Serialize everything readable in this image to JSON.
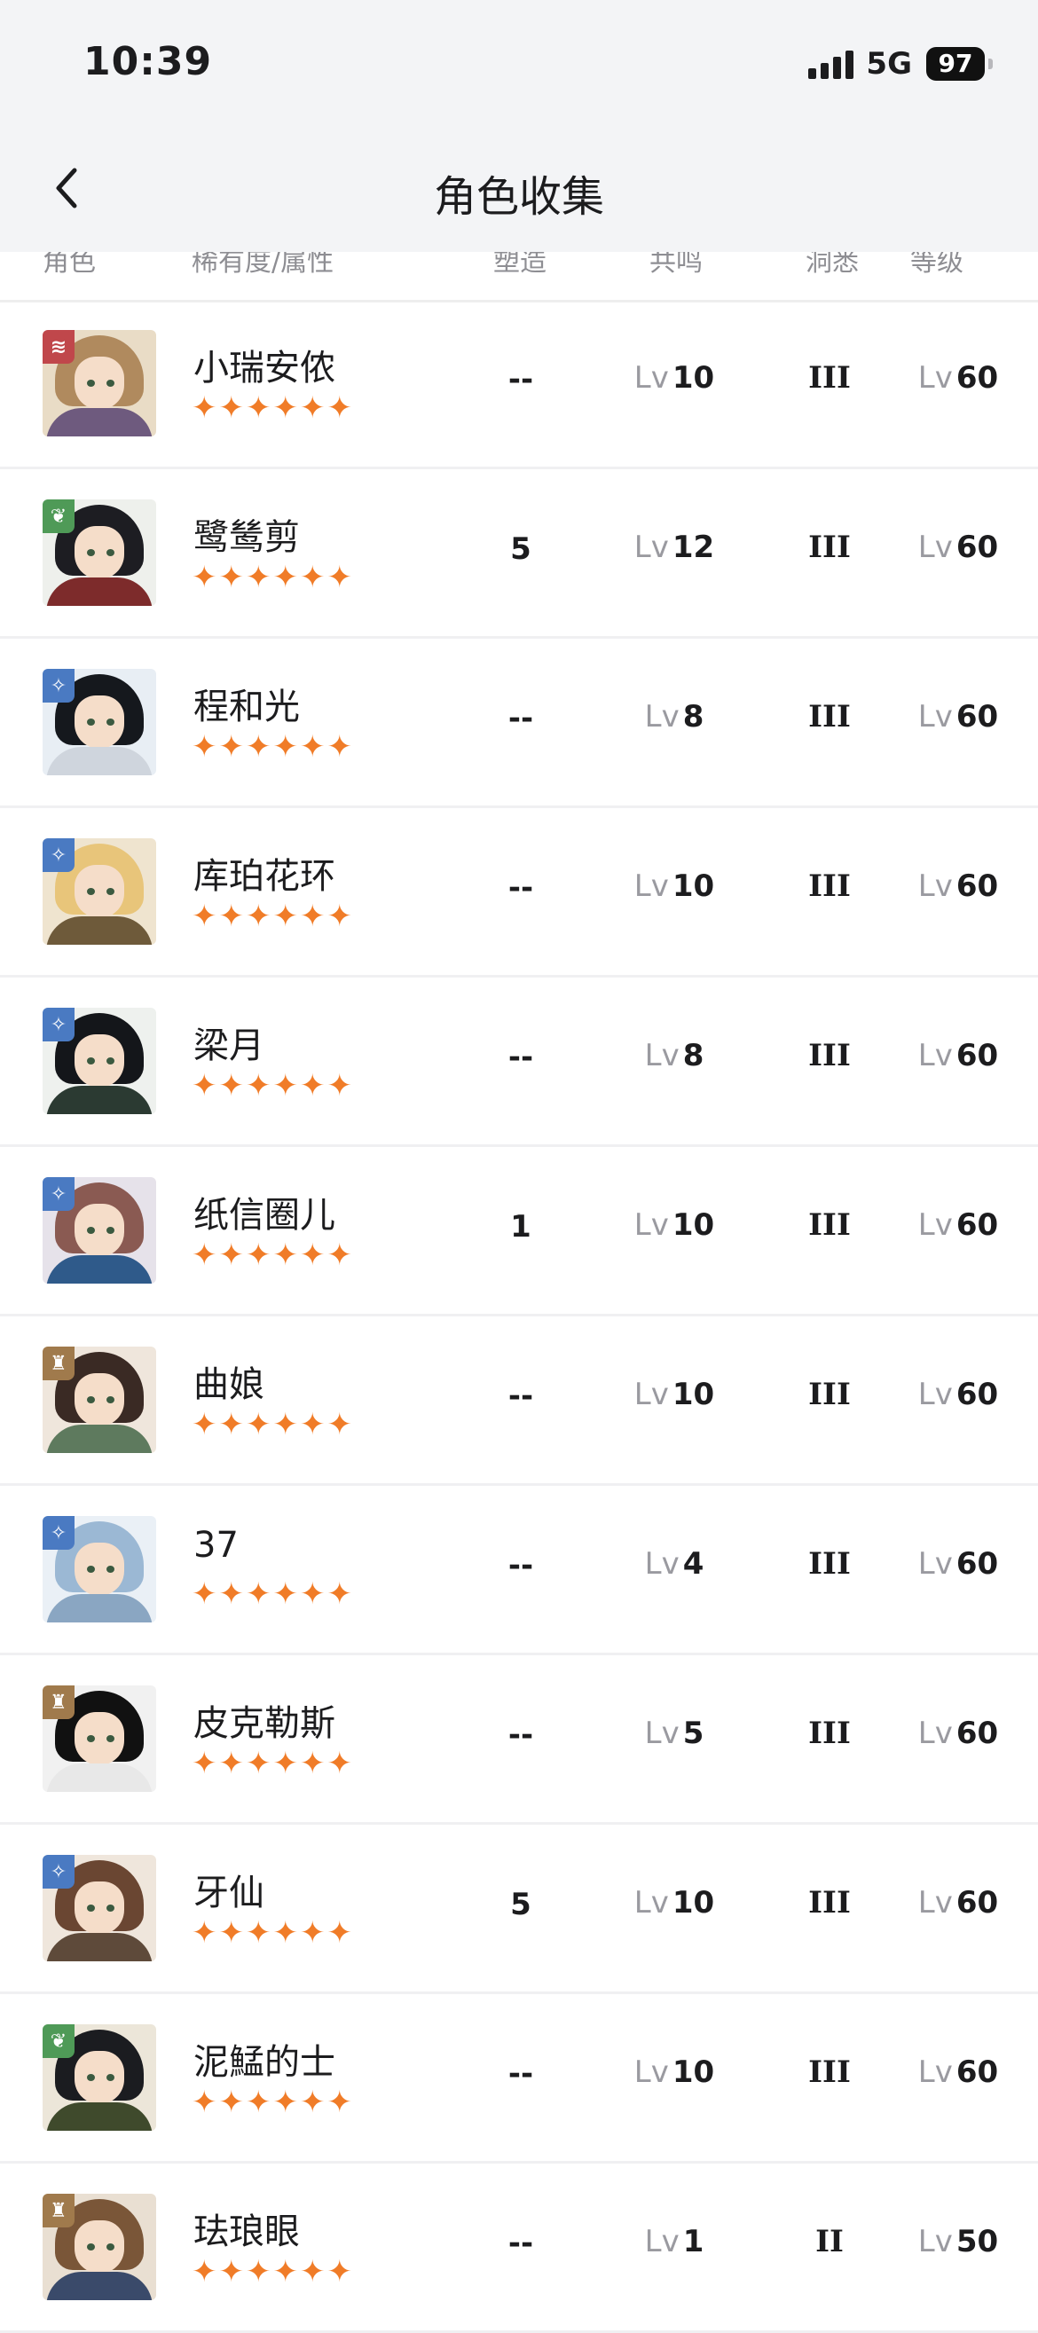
{
  "status_bar": {
    "time": "10:39",
    "network": "5G",
    "battery": "97"
  },
  "progress": 0.9,
  "header": {
    "title": "角色收集"
  },
  "columns": [
    "角色",
    "稀有度/属性",
    "塑造",
    "共鸣",
    "洞悉",
    "等级"
  ],
  "level_prefix": "Lv",
  "characters": [
    {
      "name": "小瑞安侬",
      "rarity": "✦✦✦✦✦✦",
      "element": "wind",
      "shaping": "--",
      "resonance": "10",
      "insight": "III",
      "level": "60"
    },
    {
      "name": "鹭鸶剪",
      "rarity": "✦✦✦✦✦✦",
      "element": "leaf",
      "shaping": "5",
      "resonance": "12",
      "insight": "III",
      "level": "60"
    },
    {
      "name": "程和光",
      "rarity": "✦✦✦✦✦✦",
      "element": "star",
      "shaping": "--",
      "resonance": "8",
      "insight": "III",
      "level": "60"
    },
    {
      "name": "库珀花环",
      "rarity": "✦✦✦✦✦✦",
      "element": "star",
      "shaping": "--",
      "resonance": "10",
      "insight": "III",
      "level": "60"
    },
    {
      "name": "梁月",
      "rarity": "✦✦✦✦✦✦",
      "element": "star",
      "shaping": "--",
      "resonance": "8",
      "insight": "III",
      "level": "60"
    },
    {
      "name": "纸信圈儿",
      "rarity": "✦✦✦✦✦✦",
      "element": "star",
      "shaping": "1",
      "resonance": "10",
      "insight": "III",
      "level": "60"
    },
    {
      "name": "曲娘",
      "rarity": "✦✦✦✦✦✦",
      "element": "rock",
      "shaping": "--",
      "resonance": "10",
      "insight": "III",
      "level": "60"
    },
    {
      "name": "37",
      "rarity": "✦✦✦✦✦✦",
      "element": "star",
      "shaping": "--",
      "resonance": "4",
      "insight": "III",
      "level": "60"
    },
    {
      "name": "皮克勒斯",
      "rarity": "✦✦✦✦✦✦",
      "element": "rock",
      "shaping": "--",
      "resonance": "5",
      "insight": "III",
      "level": "60"
    },
    {
      "name": "牙仙",
      "rarity": "✦✦✦✦✦✦",
      "element": "star",
      "shaping": "5",
      "resonance": "10",
      "insight": "III",
      "level": "60"
    },
    {
      "name": "泥鯭的士",
      "rarity": "✦✦✦✦✦✦",
      "element": "leaf",
      "shaping": "--",
      "resonance": "10",
      "insight": "III",
      "level": "60"
    },
    {
      "name": "珐琅眼",
      "rarity": "✦✦✦✦✦✦",
      "element": "rock",
      "shaping": "--",
      "resonance": "1",
      "insight": "II",
      "level": "50"
    }
  ]
}
